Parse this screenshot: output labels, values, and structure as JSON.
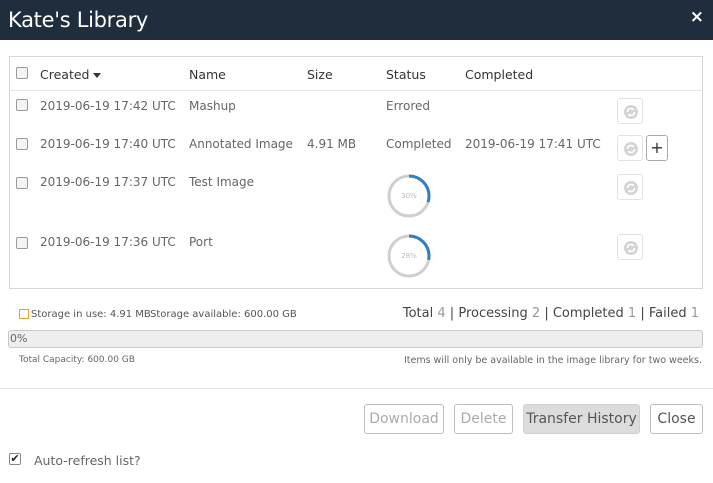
{
  "dialog": {
    "title": "Kate's Library",
    "close_glyph": "×"
  },
  "table": {
    "columns": {
      "created": "Created",
      "name": "Name",
      "size": "Size",
      "status": "Status",
      "completed": "Completed"
    },
    "sort_column": "Created",
    "sort_direction": "descending",
    "rows": [
      {
        "created": "2019-06-19 17:42 UTC",
        "name": "Mashup",
        "size": "",
        "status": "Errored",
        "completed": "",
        "progress": null,
        "has_add": false
      },
      {
        "created": "2019-06-19 17:40 UTC",
        "name": "Annotated Image",
        "size": "4.91 MB",
        "status": "Completed",
        "completed": "2019-06-19 17:41 UTC",
        "progress": null,
        "has_add": true
      },
      {
        "created": "2019-06-19 17:37 UTC",
        "name": "Test Image",
        "size": "",
        "status": "",
        "completed": "",
        "progress": 30,
        "progress_label": "30%",
        "has_add": false
      },
      {
        "created": "2019-06-19 17:36 UTC",
        "name": "Port",
        "size": "",
        "status": "",
        "completed": "",
        "progress": 28,
        "progress_label": "28%",
        "has_add": false
      }
    ],
    "row_action_icon": "refresh-icon",
    "add_glyph": "+"
  },
  "storage": {
    "in_use": "Storage in use: 4.91 MB",
    "available": "Storage available: 600.00 GB",
    "usage_percent": 0,
    "usage_label": "0%",
    "total_capacity": "Total Capacity: 600.00 GB",
    "notice": "Items will only be available in the image library for two weeks."
  },
  "totals": {
    "total_label": "Total",
    "total": "4",
    "processing_label": "Processing",
    "processing": "2",
    "completed_label": "Completed",
    "completed": "1",
    "failed_label": "Failed",
    "failed": "1",
    "separator": "|"
  },
  "buttons": {
    "download": "Download",
    "delete": "Delete",
    "transfer_history": "Transfer History",
    "close": "Close"
  },
  "auto_refresh": {
    "label": "Auto-refresh list?",
    "checked": true,
    "check_glyph": "✔"
  },
  "colors": {
    "titlebar": "#1f2d3d",
    "progress_arc": "#2f7fc1",
    "progress_track": "#cfcfcf",
    "storage_swatch": "#e8a030"
  }
}
